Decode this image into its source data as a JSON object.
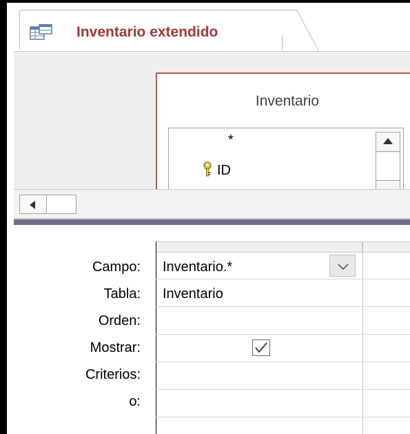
{
  "tab": {
    "title": "Inventario extendido",
    "icon": "query-icon"
  },
  "design": {
    "table_name": "Inventario",
    "fields": [
      "*",
      "ID"
    ],
    "primary_key_field": "ID"
  },
  "grid": {
    "row_labels": {
      "campo": "Campo:",
      "tabla": "Tabla:",
      "orden": "Orden:",
      "mostrar": "Mostrar:",
      "criterios": "Criterios:",
      "o": "o:"
    },
    "column1": {
      "campo": "Inventario.*",
      "tabla": "Inventario",
      "mostrar_checked": true
    }
  },
  "colors": {
    "tab_title": "#a4373a",
    "table_border": "#c0504d",
    "splitter": "#6e6e86"
  }
}
